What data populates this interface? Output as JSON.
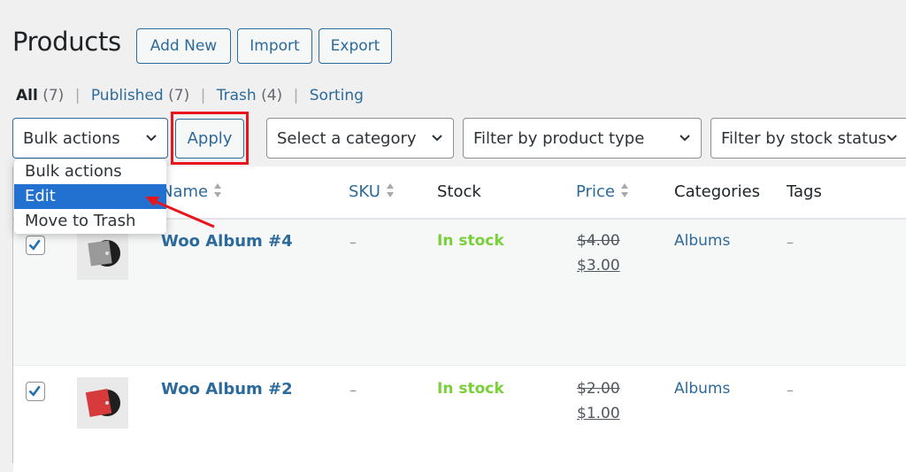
{
  "header": {
    "title": "Products",
    "buttons": {
      "add_new": "Add New",
      "import": "Import",
      "export": "Export"
    }
  },
  "subsubsub": {
    "items": [
      {
        "label": "All",
        "count": "(7)",
        "current": true
      },
      {
        "label": "Published",
        "count": "(7)"
      },
      {
        "label": "Trash",
        "count": "(4)"
      },
      {
        "label": "Sorting",
        "count": ""
      }
    ],
    "separator": "|"
  },
  "filters": {
    "bulk_actions": {
      "selected": "Bulk actions",
      "options": [
        "Bulk actions",
        "Edit",
        "Move to Trash"
      ],
      "highlighted": "Edit"
    },
    "apply_label": "Apply",
    "category": "Select a category",
    "product_type": "Filter by product type",
    "stock_status": "Filter by stock status"
  },
  "table": {
    "columns": [
      {
        "label": "Name",
        "sortable": true
      },
      {
        "label": "SKU",
        "sortable": true
      },
      {
        "label": "Stock",
        "sortable": false
      },
      {
        "label": "Price",
        "sortable": true
      },
      {
        "label": "Categories",
        "sortable": false
      },
      {
        "label": "Tags",
        "sortable": false
      }
    ],
    "rows": [
      {
        "checked": true,
        "name": "Woo Album #4",
        "sku": "–",
        "stock": "In stock",
        "regular_price": "$4.00",
        "sale_price": "$3.00",
        "categories": "Albums",
        "tags": "–",
        "thumb_color": "#9a9a9a"
      },
      {
        "checked": true,
        "name": "Woo Album #2",
        "sku": "–",
        "stock": "In stock",
        "regular_price": "$2.00",
        "sale_price": "$1.00",
        "categories": "Albums",
        "tags": "–",
        "thumb_color": "#d63a3a"
      }
    ]
  },
  "colors": {
    "link": "#2c6a9c",
    "in_stock": "#7ad03a",
    "highlight": "#2271d1",
    "annotation": "#e8151c"
  }
}
